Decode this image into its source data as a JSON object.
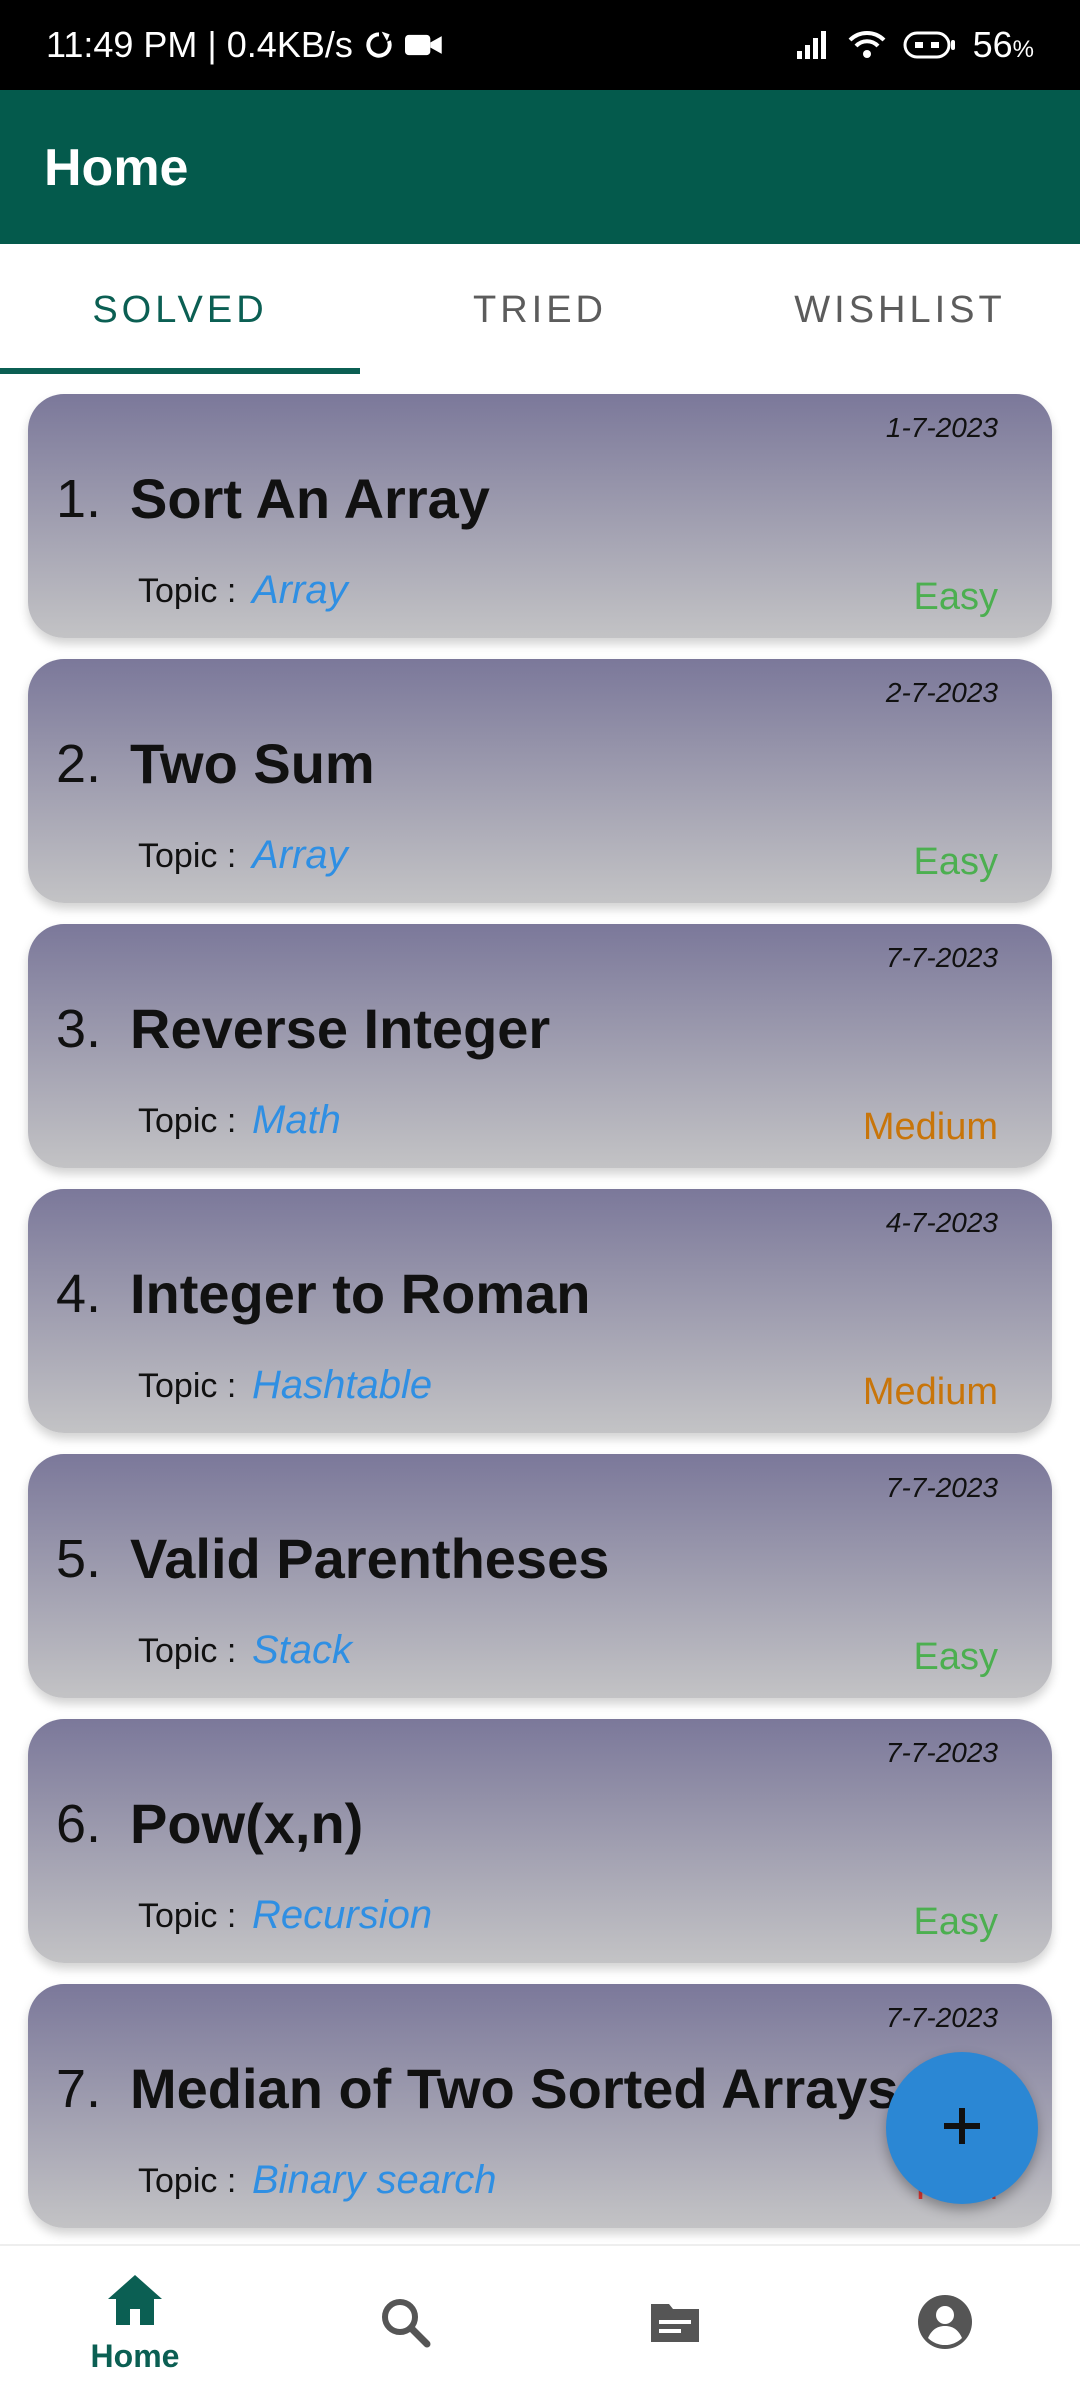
{
  "status_bar": {
    "time_speed": "11:49 PM | 0.4KB/s",
    "battery": "56",
    "battery_unit": "%"
  },
  "app_bar": {
    "title": "Home"
  },
  "tabs": [
    {
      "label": "SOLVED",
      "active": true
    },
    {
      "label": "TRIED",
      "active": false
    },
    {
      "label": "WISHLIST",
      "active": false
    }
  ],
  "problems": [
    {
      "number": "1.",
      "title": "Sort An Array",
      "date": "1-7-2023",
      "topic_label": "Topic :",
      "topic": "Array",
      "difficulty": "Easy",
      "difficulty_color": "#4caf50"
    },
    {
      "number": "2.",
      "title": "Two Sum",
      "date": "2-7-2023",
      "topic_label": "Topic :",
      "topic": "Array",
      "difficulty": "Easy",
      "difficulty_color": "#4caf50"
    },
    {
      "number": "3.",
      "title": "Reverse Integer",
      "date": "7-7-2023",
      "topic_label": "Topic :",
      "topic": "Math",
      "difficulty": "Medium",
      "difficulty_color": "#c8750a"
    },
    {
      "number": "4.",
      "title": "Integer to Roman",
      "date": "4-7-2023",
      "topic_label": "Topic :",
      "topic": "Hashtable",
      "difficulty": "Medium",
      "difficulty_color": "#c8750a"
    },
    {
      "number": "5.",
      "title": "Valid Parentheses",
      "date": "7-7-2023",
      "topic_label": "Topic :",
      "topic": "Stack",
      "difficulty": "Easy",
      "difficulty_color": "#4caf50"
    },
    {
      "number": "6.",
      "title": "Pow(x,n)",
      "date": "7-7-2023",
      "topic_label": "Topic :",
      "topic": "Recursion",
      "difficulty": "Easy",
      "difficulty_color": "#4caf50"
    },
    {
      "number": "7.",
      "title": "Median of Two Sorted Arrays",
      "date": "7-7-2023",
      "topic_label": "Topic :",
      "topic": "Binary search",
      "difficulty": "Hard",
      "difficulty_color": "#e53935"
    }
  ],
  "fab": {
    "icon": "plus-icon"
  },
  "bottom_nav": [
    {
      "icon": "home-icon",
      "label": "Home",
      "active": true
    },
    {
      "icon": "search-icon",
      "label": "",
      "active": false
    },
    {
      "icon": "notes-icon",
      "label": "",
      "active": false
    },
    {
      "icon": "account-icon",
      "label": "",
      "active": false
    }
  ],
  "colors": {
    "app_bar": "#045a4c",
    "accent": "#0b5f53",
    "fab": "#2b87d4",
    "topic": "#2f8fe3"
  }
}
